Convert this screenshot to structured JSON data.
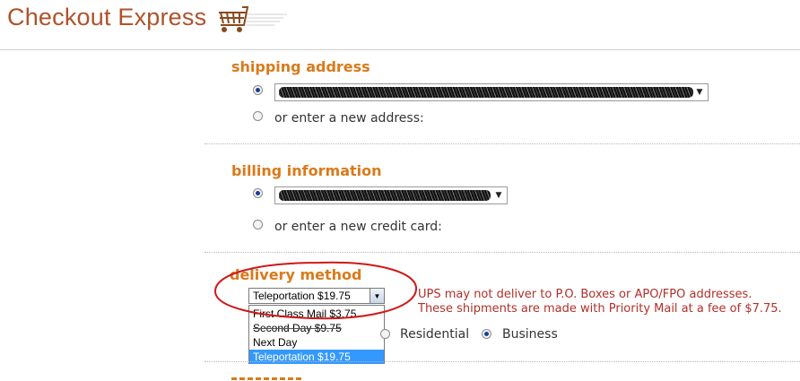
{
  "header": {
    "title": "Checkout Express",
    "cart_icon": "shopping-cart-icon"
  },
  "shipping": {
    "title": "shipping address",
    "saved_selected": true,
    "new_option_label": "or enter a new address:"
  },
  "billing": {
    "title": "billing information",
    "saved_selected": true,
    "new_option_label": "or enter a new credit card:"
  },
  "delivery": {
    "title": "delivery method",
    "selected": "Teleportation $19.75",
    "options": [
      "First Class Mail $3.75",
      "Second Day $9.75",
      "Next Day",
      "Teleportation $19.75"
    ],
    "note_line1": "UPS may not deliver to P.O. Boxes or APO/FPO addresses.",
    "note_line2": "These shipments are made with Priority Mail at a fee of $7.75.",
    "address_type": {
      "residential_label": "Residential",
      "business_label": "Business",
      "selected": "Business"
    }
  },
  "colors": {
    "title_brown": "#b0522a",
    "section_orange": "#d97a1a",
    "note_red": "#b0302a",
    "highlight_blue": "#3399ff",
    "annotation_red": "#d01818"
  }
}
